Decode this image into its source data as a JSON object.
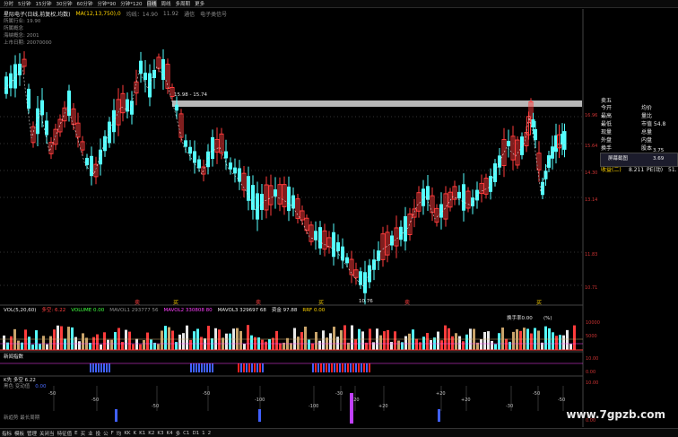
{
  "period_tabs": [
    "分时",
    "5分钟",
    "15分钟",
    "30分钟",
    "60分钟",
    "分钟*90",
    "分钟*120",
    "日线",
    "周线",
    "多周期",
    "更多"
  ],
  "active_tab_index": 7,
  "stock_info": {
    "name": "星际电子(日线,前复权,均数)",
    "ma_label": "MA(12,13,750),0",
    "ma_value_label": "均线：14.90",
    "ma_value2": "11.92",
    "tags": [
      "通信",
      "电子类信号"
    ]
  },
  "left_notes": [
    "所属行业: 19.90",
    "所属概念",
    "海峡概念: 2001",
    "上市日期: 20070000"
  ],
  "price_annotations": {
    "high_note": "15.98 - 15.74",
    "low_note": "10.76"
  },
  "price_axis": [
    "16.96",
    "15.64",
    "14.30",
    "13.14",
    "11.83",
    "10.71"
  ],
  "right_panel": {
    "rows": [
      {
        "k": "卖五",
        "v": "",
        "c": "white"
      },
      {
        "k": "今开",
        "v": "均价",
        "c": "white"
      },
      {
        "k": "最高",
        "v": "量比",
        "c": "white"
      },
      {
        "k": "最低",
        "v": "市值  54.8",
        "c": "white"
      },
      {
        "k": "现量",
        "v": "总量",
        "c": "white"
      },
      {
        "k": "外盘",
        "v": "内盘",
        "c": "white"
      },
      {
        "k": "换手",
        "v": "股本",
        "c": "white"
      }
    ],
    "popup_title": "屏幕截图",
    "popup_value": "3.75",
    "popup_value2": "3.69",
    "bottom_row": {
      "k": "收益(二)",
      "v": "8.211",
      "pe": "PE(动)",
      "pe_v": "51."
    }
  },
  "volume_panel": {
    "label": "VOL(5,20,60)",
    "tag": "多空: 6.22",
    "volume": "VOLUME 0.00",
    "ma1": "MAVOL1 293777 56",
    "ma2": "MAVOL2 330808 80",
    "ma3": "MAVOL3 329697 68",
    "extra": "资金 97.88",
    "rrf": "RRF 0.00",
    "rate": "换手率0.00",
    "pct": "(%)",
    "axis": [
      "10000",
      "5000"
    ]
  },
  "indicator1": {
    "label": "新闻指数",
    "axis": [
      "10.00",
      "0.00"
    ]
  },
  "indicator2": {
    "label": "K先 多空 6.22",
    "sub1": "黑色 变动值",
    "sub2": "0.00",
    "axis": [
      "10.00",
      "0.00"
    ]
  },
  "indicator_markers": [
    "-50",
    "-50",
    "-50",
    "-50",
    "-100",
    "-100",
    "-30",
    "+20",
    "+20",
    "+20",
    "+20",
    "-30",
    "-50"
  ],
  "signal_labels": [
    "卖",
    "买",
    "卖",
    "买",
    "卖",
    "买"
  ],
  "footer_note": "新趋势 最长周期",
  "bottom_bar": [
    "指标",
    "模板",
    "管理",
    "关闭当",
    "特征值",
    "E",
    "买",
    "业",
    "投",
    "公",
    "F",
    "均",
    "KK",
    "K",
    "K1",
    "K2",
    "K3",
    "K4",
    "多",
    "C1",
    "D1",
    "1",
    "2"
  ],
  "watermark": "www.7gpzb.com",
  "colors": {
    "up": "#ff3c3c",
    "down": "#54ffff",
    "bg": "#000000",
    "gray_bar": "#b8b8b8",
    "ma": "#ffffff"
  }
}
